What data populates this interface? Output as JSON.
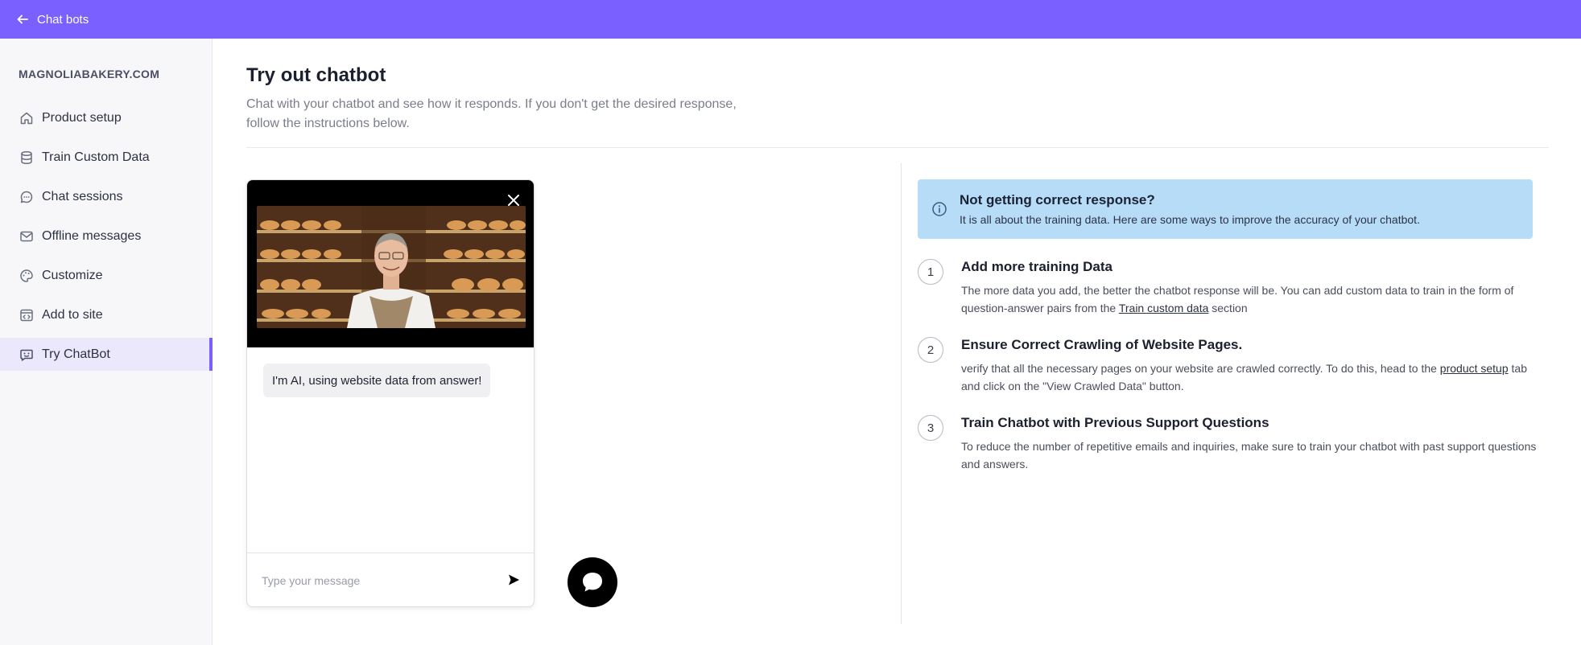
{
  "topbar": {
    "back_label": "Chat bots"
  },
  "sidebar": {
    "brand": "MAGNOLIABAKERY.COM",
    "items": [
      {
        "label": "Product setup",
        "icon": "home-icon"
      },
      {
        "label": "Train Custom Data",
        "icon": "database-icon"
      },
      {
        "label": "Chat sessions",
        "icon": "chat-bubble-icon"
      },
      {
        "label": "Offline messages",
        "icon": "mail-icon"
      },
      {
        "label": "Customize",
        "icon": "palette-icon"
      },
      {
        "label": "Add to site",
        "icon": "code-window-icon"
      },
      {
        "label": "Try ChatBot",
        "icon": "bot-icon",
        "active": true
      }
    ]
  },
  "main": {
    "title": "Try out chatbot",
    "subtitle": "Chat with your chatbot and see how it responds. If you don't get the desired response, follow the instructions below."
  },
  "widget": {
    "bot_message": "I'm AI, using website data from answer!",
    "input_placeholder": "Type your message"
  },
  "help": {
    "alert_title": "Not getting correct response?",
    "alert_text": "It is all about the training data. Here are some ways to improve the accuracy of your chatbot.",
    "steps": [
      {
        "num": "1",
        "title": "Add more training Data",
        "desc_before": "The more data you add, the better the chatbot response will be. You can add custom data to train in the form of question-answer pairs from the ",
        "link": "Train custom data",
        "desc_after": " section"
      },
      {
        "num": "2",
        "title": "Ensure Correct Crawling of Website Pages.",
        "desc_before": "verify that all the necessary pages on your website are crawled correctly. To do this, head to the ",
        "link": "product setup",
        "desc_after": " tab and click on the \"View Crawled Data\" button."
      },
      {
        "num": "3",
        "title": "Train Chatbot with Previous Support Questions",
        "desc": "To reduce the number of repetitive emails and inquiries, make sure to train your chatbot with past support questions and answers."
      }
    ]
  },
  "colors": {
    "accent": "#7a60ff",
    "alert_bg": "#b7dcf8",
    "sidebar_bg": "#f7f7fa"
  }
}
